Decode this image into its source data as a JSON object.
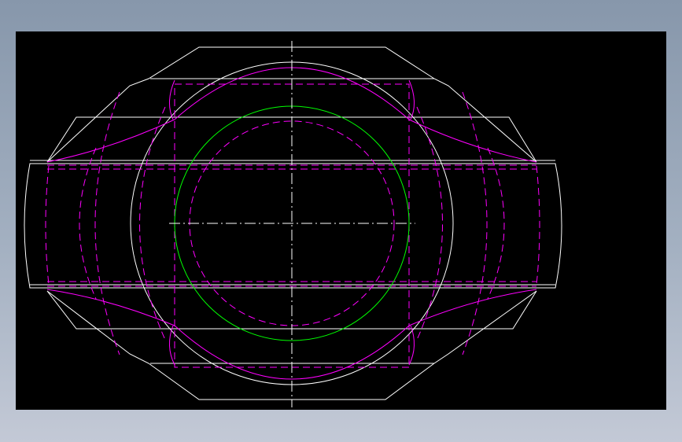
{
  "drawing": {
    "colors": {
      "background": "#000000",
      "outline": "#ffffff",
      "hidden_lines": "#ff00ff",
      "bore_circle": "#00ff00",
      "centerline": "#ffffff",
      "window_gradient_top": "#8797ab",
      "window_gradient_bottom": "#c3c9d6"
    },
    "line_types": {
      "outline": "continuous",
      "hidden_lines": "dashed",
      "centerline": "dash-dot"
    }
  }
}
